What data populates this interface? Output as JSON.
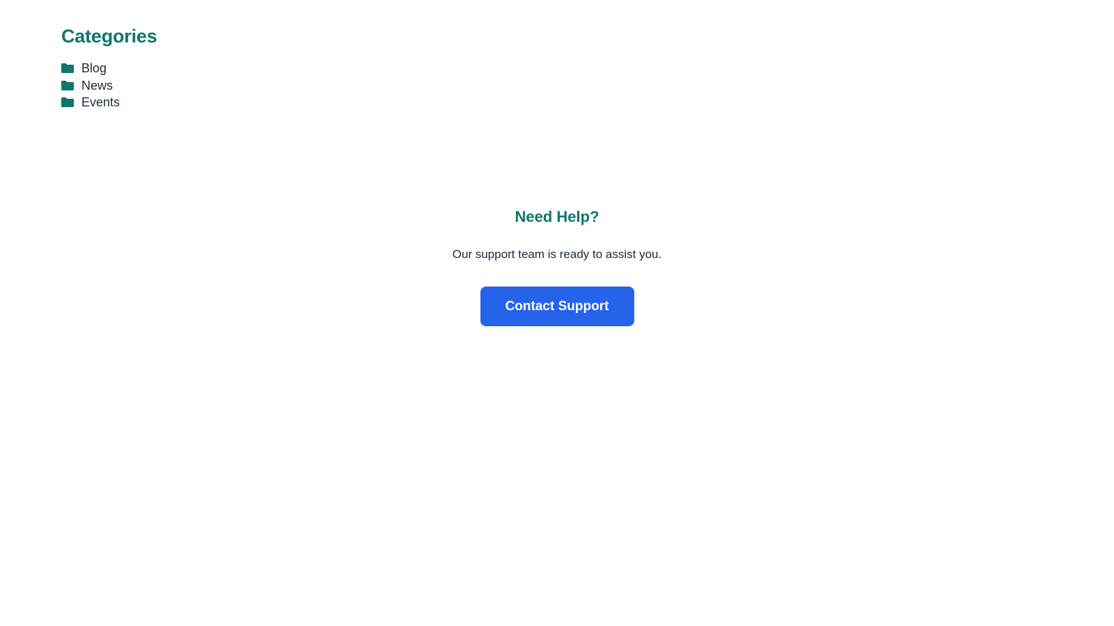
{
  "colors": {
    "accent": "#0f766e",
    "button": "#2563eb",
    "text": "#1f2937"
  },
  "categories": {
    "title": "Categories",
    "items": [
      {
        "label": "Blog",
        "icon": "folder-icon"
      },
      {
        "label": "News",
        "icon": "folder-icon"
      },
      {
        "label": "Events",
        "icon": "folder-icon"
      }
    ]
  },
  "help": {
    "title": "Need Help?",
    "text": "Our support team is ready to assist you.",
    "button_label": "Contact Support"
  }
}
